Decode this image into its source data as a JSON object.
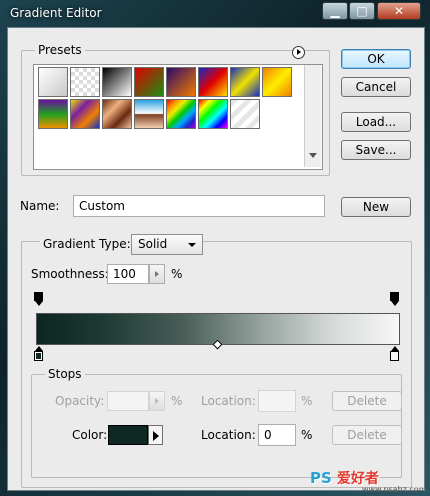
{
  "window": {
    "title": "Gradient Editor",
    "min_glyph": "▁",
    "max_glyph": "□",
    "close_glyph": "✕"
  },
  "presets": {
    "title": "Presets",
    "menu_icon": "circle-arrow-icon",
    "swatches": [
      {
        "name": "foreground-to-background",
        "css": "linear-gradient(135deg,#fff,#c8c8c8)"
      },
      {
        "name": "foreground-to-transparent",
        "css": "repeating-conic-gradient(#ddd 0 25%,#fff 0 50%) 0 0/8px 8px"
      },
      {
        "name": "black-white",
        "css": "linear-gradient(135deg,#000,#fff)"
      },
      {
        "name": "red-green",
        "css": "linear-gradient(135deg,#e00000,#1a8f12)"
      },
      {
        "name": "violet-orange",
        "css": "linear-gradient(135deg,#2a0a6a,#f07a00)"
      },
      {
        "name": "blue-red-yellow",
        "css": "linear-gradient(135deg,#1528c8,#e00000,#ffe000)"
      },
      {
        "name": "blue-yellow-blue",
        "css": "linear-gradient(135deg,#1530c0,#f0e000,#1530c0)"
      },
      {
        "name": "orange-yellow-orange",
        "css": "linear-gradient(135deg,#f08000,#ffee00,#f08000)"
      },
      {
        "name": "violet-green-orange",
        "css": "linear-gradient(180deg,#6a10a0,#20a020,#f09000)"
      },
      {
        "name": "yellow-violet-orange-blue",
        "css": "linear-gradient(135deg,#f0e000,#7a20a0,#f08000,#1530c0)"
      },
      {
        "name": "copper",
        "css": "linear-gradient(135deg,#6a2a10,#f0b080,#6a2a10,#f0c0a0)"
      },
      {
        "name": "chrome",
        "css": "linear-gradient(180deg,#2aa0e0,#ffffff 48%,#804020 52%,#f0d0b0)"
      },
      {
        "name": "spectrum",
        "css": "linear-gradient(135deg,#e00,#f80,#ee0,#0c0,#0af,#22c,#a0c)"
      },
      {
        "name": "transparent-rainbow",
        "css": "linear-gradient(135deg,#f00,#ff0,#0f0,#0ff,#00f,#f0f)"
      },
      {
        "name": "transparent-stripes",
        "css": "repeating-linear-gradient(135deg,#e6e6e6 0 5px,#fff 5px 10px)"
      }
    ]
  },
  "buttons": {
    "ok": "OK",
    "cancel": "Cancel",
    "load": "Load...",
    "save": "Save...",
    "new": "New"
  },
  "name_row": {
    "label": "Name:",
    "value": "Custom"
  },
  "gradient": {
    "type_label": "Gradient Type:",
    "type_value": "Solid",
    "smoothness_label": "Smoothness:",
    "smoothness_value": "100",
    "smoothness_unit": "%",
    "start_color": "#0e2823",
    "end_color": "#f7f7f7",
    "midpoint_percent": 50
  },
  "stops": {
    "title": "Stops",
    "opacity_label": "Opacity:",
    "opacity_unit": "%",
    "opacity_location_label": "Location:",
    "opacity_location_unit": "%",
    "opacity_delete": "Delete",
    "color_label": "Color:",
    "color_value": "#0e2823",
    "color_location_label": "Location:",
    "color_location_value": "0",
    "color_location_unit": "%",
    "color_delete": "Delete"
  },
  "watermark": {
    "ps": "PS",
    "cn": "爱好者",
    "url": "www.psahz.com"
  }
}
